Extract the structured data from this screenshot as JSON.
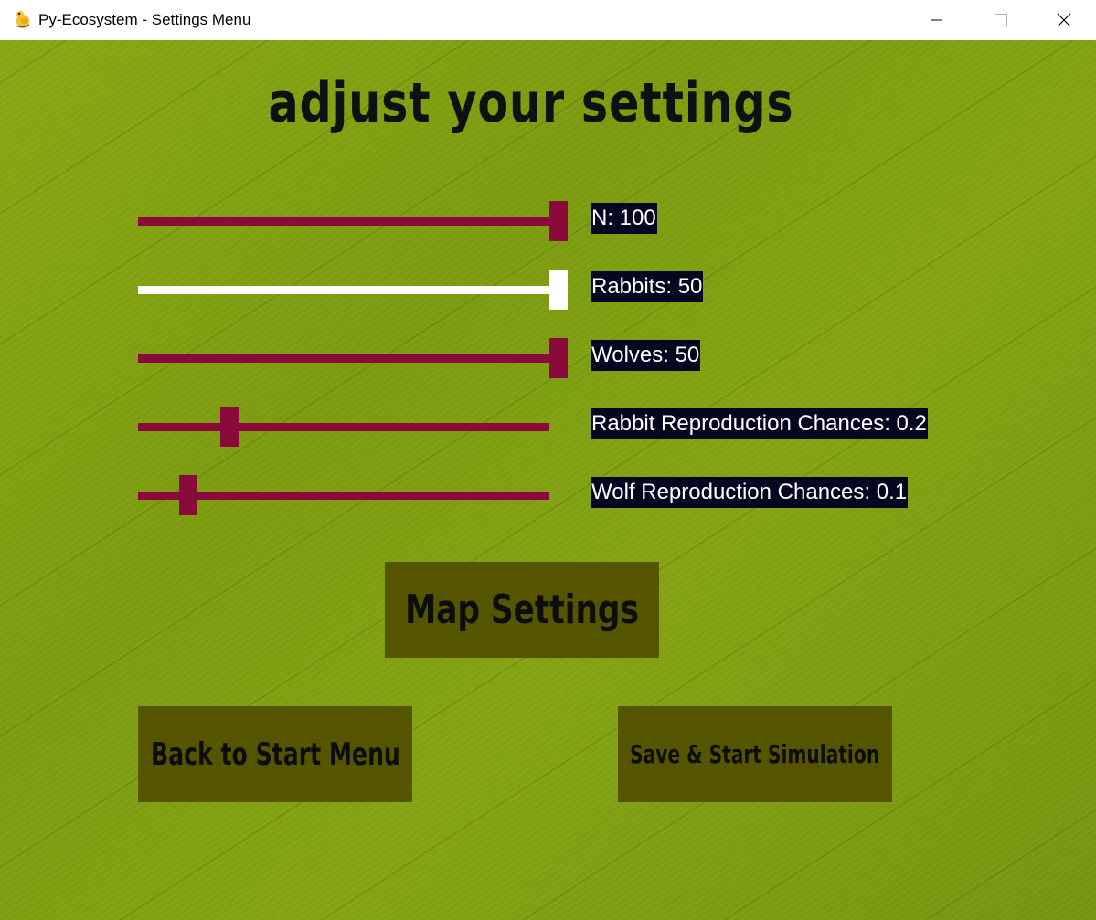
{
  "window": {
    "title": "Py-Ecosystem - Settings Menu",
    "icon": "python-snake-icon",
    "controls": [
      "minimize-icon",
      "maximize-icon",
      "close-icon"
    ]
  },
  "page": {
    "title": "adjust your settings"
  },
  "sliders": [
    {
      "label": "N: 100",
      "value_fraction": 1.0,
      "track_color": "#8b0a3c",
      "thumb_color": "#8b0a3c"
    },
    {
      "label": "Rabbits: 50",
      "value_fraction": 1.0,
      "track_color": "#ffffff",
      "thumb_color": "#ffffff"
    },
    {
      "label": "Wolves: 50",
      "value_fraction": 1.0,
      "track_color": "#8b0a3c",
      "thumb_color": "#8b0a3c"
    },
    {
      "label": "Rabbit Reproduction Chances: 0.2",
      "value_fraction": 0.2,
      "track_color": "#8b0a3c",
      "thumb_color": "#8b0a3c"
    },
    {
      "label": "Wolf Reproduction Chances: 0.1",
      "value_fraction": 0.1,
      "track_color": "#8b0a3c",
      "thumb_color": "#8b0a3c"
    }
  ],
  "buttons": {
    "map_settings": "Map Settings",
    "back": "Back to Start Menu",
    "save_start": "Save & Start Simulation"
  },
  "colors": {
    "button_bg": "#555500",
    "label_bg": "#060620",
    "background": "#7a9a14"
  }
}
